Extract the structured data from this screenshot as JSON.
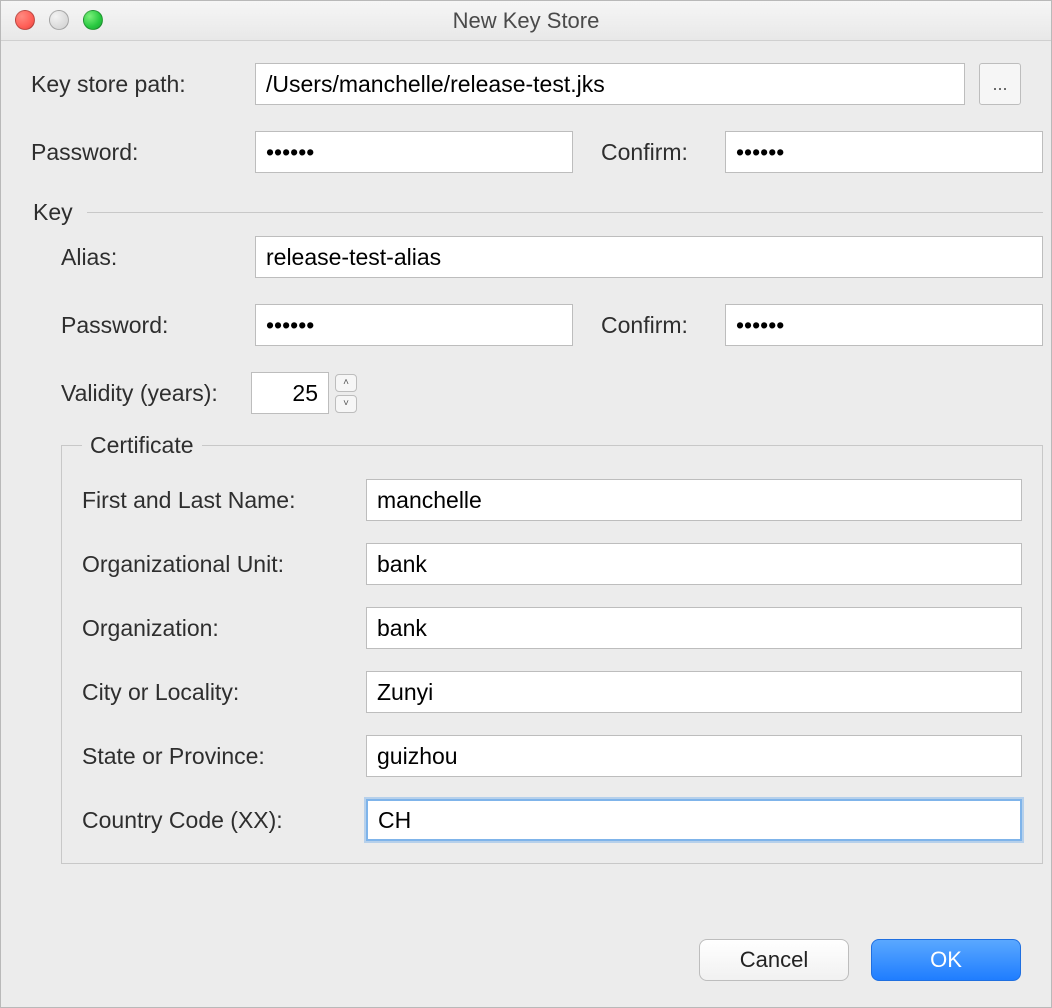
{
  "window": {
    "title": "New Key Store"
  },
  "keystore": {
    "path_label": "Key store path:",
    "path_value": "/Users/manchelle/release-test.jks",
    "browse_label": "...",
    "password_label": "Password:",
    "password_value": "••••••",
    "confirm_label": "Confirm:",
    "confirm_value": "••••••"
  },
  "key": {
    "legend": "Key",
    "alias_label": "Alias:",
    "alias_value": "release-test-alias",
    "password_label": "Password:",
    "password_value": "••••••",
    "confirm_label": "Confirm:",
    "confirm_value": "••••••",
    "validity_label": "Validity (years):",
    "validity_value": "25"
  },
  "certificate": {
    "legend": "Certificate",
    "name_label": "First and Last Name:",
    "name_value": "manchelle",
    "ou_label": "Organizational Unit:",
    "ou_value": "bank",
    "org_label": "Organization:",
    "org_value": "bank",
    "city_label": "City or Locality:",
    "city_value": "Zunyi",
    "state_label": "State or Province:",
    "state_value": "guizhou",
    "country_label": "Country Code (XX):",
    "country_value": "CH"
  },
  "buttons": {
    "cancel": "Cancel",
    "ok": "OK"
  }
}
